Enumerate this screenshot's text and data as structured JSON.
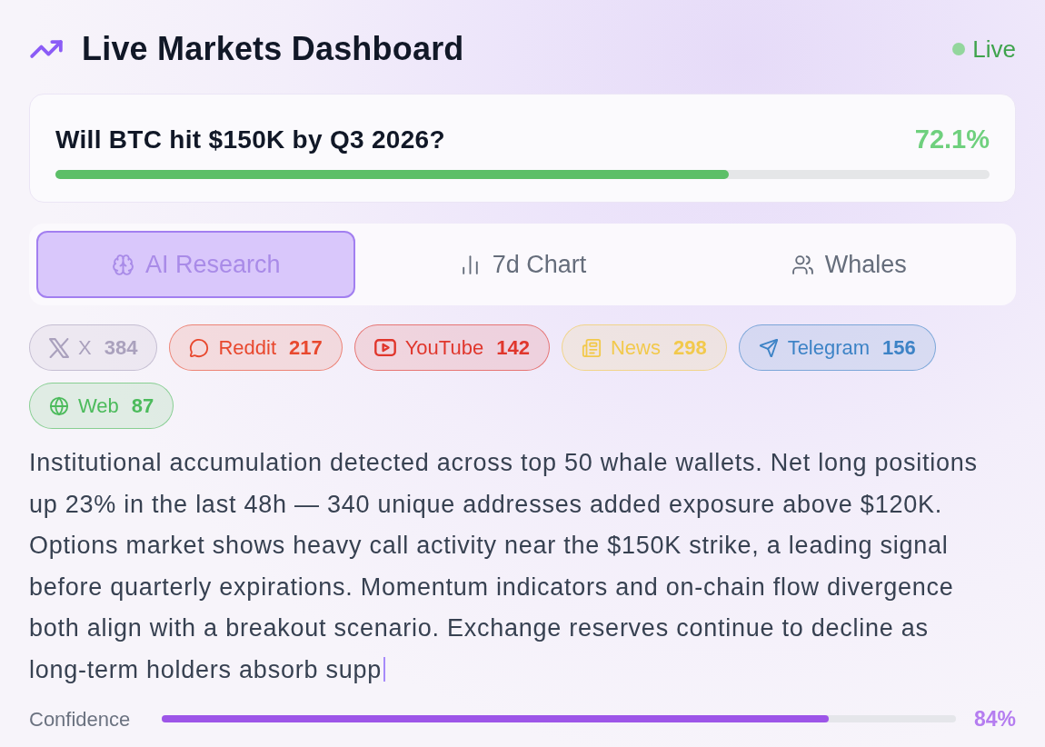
{
  "header": {
    "title": "Live Markets Dashboard",
    "live_label": "Live"
  },
  "market": {
    "question": "Will BTC hit $150K by Q3 2026?",
    "probability": "72.1%",
    "level": 0.721
  },
  "tabs": [
    {
      "label": "AI Research",
      "kind": "research",
      "selected": true
    },
    {
      "label": "7d Chart",
      "kind": "chart",
      "selected": false
    },
    {
      "label": "Whales",
      "kind": "people",
      "selected": false
    }
  ],
  "sources": [
    {
      "name": "X",
      "count": "384",
      "kind": "x",
      "color": "#aaa1bd"
    },
    {
      "name": "Reddit",
      "count": "217",
      "kind": "chat",
      "color": "#e8482e"
    },
    {
      "name": "YouTube",
      "count": "142",
      "kind": "video",
      "color": "#e0362c"
    },
    {
      "name": "News",
      "count": "298",
      "kind": "news",
      "color": "#f2c94c"
    },
    {
      "name": "Telegram",
      "count": "156",
      "kind": "send",
      "color": "#3d83c6"
    },
    {
      "name": "Web",
      "count": "87",
      "kind": "globe",
      "color": "#4cbb5c"
    }
  ],
  "research": {
    "text": "Institutional accumulation detected across top 50 whale wallets. Net long positions up 23% in the last 48h — 340 unique addresses added exposure above $120K. Options market shows heavy call activity near the $150K strike, a leading signal before quarterly expirations. Momentum indicators and on-chain flow divergence both align with a breakout scenario. Exchange reserves continue to decline as long-term holders absorb supp",
    "typing": true,
    "confidence": {
      "label": "Confidence",
      "level": 0.84,
      "reading": "84%"
    }
  }
}
